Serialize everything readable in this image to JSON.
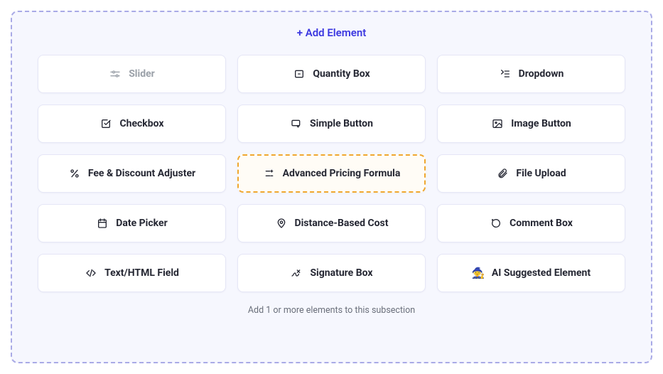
{
  "header": {
    "add_element": "+ Add Element"
  },
  "cards": {
    "slider": "Slider",
    "quantity_box": "Quantity Box",
    "dropdown": "Dropdown",
    "checkbox": "Checkbox",
    "simple_button": "Simple Button",
    "image_button": "Image Button",
    "fee_discount": "Fee & Discount Adjuster",
    "advanced_pricing": "Advanced Pricing Formula",
    "file_upload": "File Upload",
    "date_picker": "Date Picker",
    "distance_cost": "Distance-Based Cost",
    "comment_box": "Comment Box",
    "text_html": "Text/HTML Field",
    "signature_box": "Signature Box",
    "ai_suggested": "AI Suggested Element"
  },
  "hint": "Add 1 or more elements to this subsection"
}
